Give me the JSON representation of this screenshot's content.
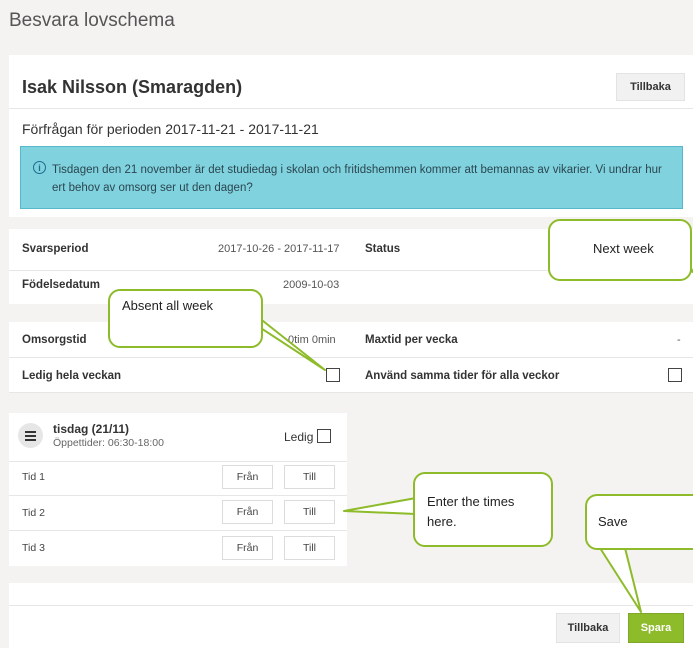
{
  "page": {
    "heading": "Besvara lovschema"
  },
  "student": {
    "name": "Isak Nilsson (Smaragden)",
    "back_label": "Tillbaka"
  },
  "request": {
    "period": "Förfrågan för perioden 2017-11-21 - 2017-11-21"
  },
  "info": {
    "icon": "info-icon",
    "text": "Tisdagen den 21 november är det studiedag i skolan och fritidshemmen kommer att bemannas av vikarier. Vi undrar hur ert behov av omsorg ser ut den dagen?"
  },
  "details": {
    "svarsperiod_label": "Svarsperiod",
    "svarsperiod_value": "2017-10-26 - 2017-11-17",
    "status_label": "Status",
    "fodelsedatum_label": "Födelsedatum",
    "fodelsedatum_value": "2009-10-03"
  },
  "care": {
    "omsorgstid_label": "Omsorgstid",
    "omsorgstid_value": "0tim 0min",
    "maxtid_label": "Maxtid per vecka",
    "maxtid_value": "-",
    "ledig_label": "Ledig hela veckan",
    "same_times_label": "Använd samma tider för alla veckor"
  },
  "schedule": {
    "day": "tisdag (21/11)",
    "opening_hours": "Öppettider: 06:30-18:00",
    "ledig_label": "Ledig",
    "rows": [
      {
        "label": "Tid 1",
        "from": "Från",
        "to": "Till"
      },
      {
        "label": "Tid 2",
        "from": "Från",
        "to": "Till"
      },
      {
        "label": "Tid 3",
        "from": "Från",
        "to": "Till"
      }
    ]
  },
  "callouts": {
    "next_week": "Next week",
    "absent": "Absent all week",
    "enter_times": "Enter the times here.",
    "save": "Save"
  },
  "footer": {
    "back_label": "Tillbaka",
    "save_label": "Spara"
  },
  "colors": {
    "accent": "#8dbb2a",
    "info_bg": "#7fd2de"
  }
}
